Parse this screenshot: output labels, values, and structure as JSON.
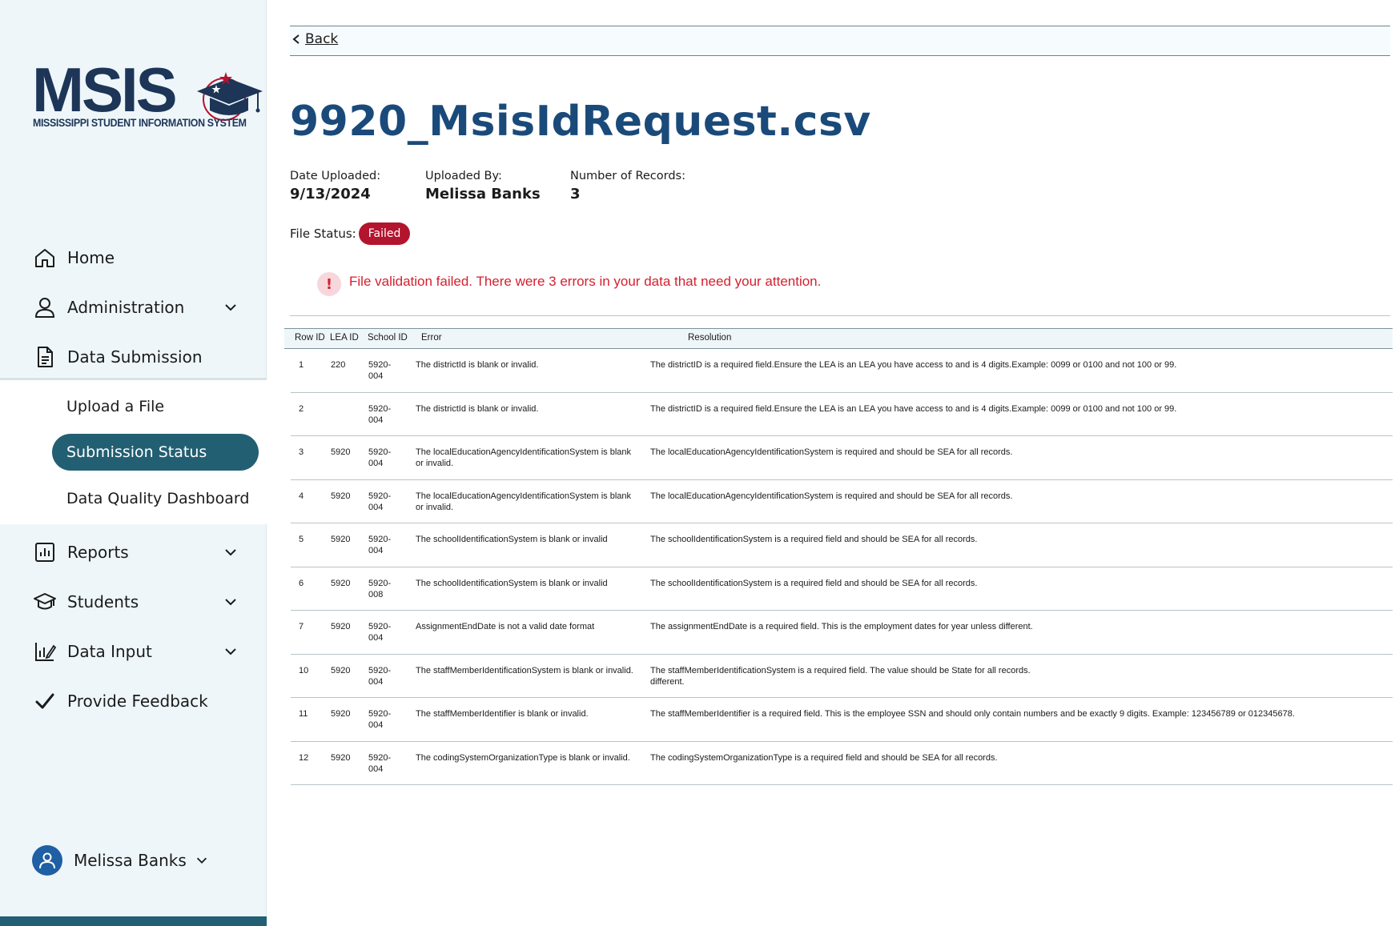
{
  "logo": {
    "word": "MSIS",
    "subtitle": "MISSISSIPPI STUDENT INFORMATION SYSTEM"
  },
  "nav": {
    "home": "Home",
    "administration": "Administration",
    "data_submission": "Data Submission",
    "sub": {
      "upload": "Upload a File",
      "status": "Submission Status",
      "dq": "Data Quality Dashboard"
    },
    "reports": "Reports",
    "students": "Students",
    "data_input": "Data Input",
    "feedback": "Provide Feedback"
  },
  "user": {
    "name": "Melissa Banks"
  },
  "back_label": "Back",
  "file": {
    "name": "9920_MsisIdRequest.csv",
    "date_label": "Date Uploaded:",
    "date": "9/13/2024",
    "by_label": "Uploaded By:",
    "by": "Melissa Banks",
    "records_label": "Number of Records:",
    "records": "3",
    "status_label": "File Status:",
    "status": "Failed"
  },
  "alert": {
    "icon": "!",
    "text": "File validation failed. There were 3 errors in your data that need your attention."
  },
  "colors": {
    "sidebar": "#eef6fa",
    "active_pill": "#235f72",
    "title": "#1a4a7a",
    "failed": "#b3142e",
    "alert": "#d4202f"
  },
  "table": {
    "headers": {
      "row_id": "Row ID",
      "lea_id": "LEA ID",
      "school_id": "School ID",
      "error": "Error",
      "resolution": "Resolution"
    },
    "rows": [
      {
        "row_id": "1",
        "lea_id": "220",
        "school_id": "5920-\n004",
        "error": "The districtId is blank or invalid.",
        "resolution": "The districtID is a required field.Ensure the LEA is an LEA you have access to and is 4 digits.Example: 0099 or 0100 and not 100 or 99."
      },
      {
        "row_id": "2",
        "lea_id": "",
        "school_id": "5920-\n004",
        "error": "The districtId is blank or invalid.",
        "resolution": "The districtID is a required field.Ensure the LEA is an LEA you have access to and is 4 digits.Example: 0099 or 0100 and not 100 or 99."
      },
      {
        "row_id": "3",
        "lea_id": "5920",
        "school_id": "5920-\n004",
        "error": "The localEducationAgencyIdentificationSystem is blank\nor invalid.",
        "resolution": "The localEducationAgencyIdentificationSystem is required and should be SEA for all records."
      },
      {
        "row_id": "4",
        "lea_id": "5920",
        "school_id": "5920-\n004",
        "error": "The localEducationAgencyIdentificationSystem is blank\nor invalid.",
        "resolution": "The localEducationAgencyIdentificationSystem is required and should be SEA for all records."
      },
      {
        "row_id": "5",
        "lea_id": "5920",
        "school_id": "5920-\n004",
        "error": "The schoolIdentificationSystem is blank or invalid",
        "resolution": "The schoolIdentificationSystem is a required field and should be SEA for all records."
      },
      {
        "row_id": "6",
        "lea_id": "5920",
        "school_id": "5920-\n008",
        "error": "The schoolIdentificationSystem is blank or invalid",
        "resolution": "The schoolIdentificationSystem is a required field and should be SEA for all records."
      },
      {
        "row_id": "7",
        "lea_id": "5920",
        "school_id": "5920-\n004",
        "error": "AssignmentEndDate is not a valid date format",
        "resolution": "The assignmentEndDate is a required field. This is the employment dates for year unless different."
      },
      {
        "row_id": "10",
        "lea_id": "5920",
        "school_id": "5920-\n004",
        "error": "The staffMemberIdentificationSystem is blank or invalid.",
        "resolution": "The staffMemberIdentificationSystem is a required field. The value should be State for all records.\ndifferent."
      },
      {
        "row_id": "11",
        "lea_id": "5920",
        "school_id": "5920-\n004",
        "error": "The staffMemberIdentifier is blank or invalid.",
        "resolution": "The staffMemberIdentifier is a required field. This is the employee SSN and should only contain numbers and be exactly 9 digits. Example: 123456789 or 012345678."
      },
      {
        "row_id": "12",
        "lea_id": "5920",
        "school_id": "5920-\n004",
        "error": "The codingSystemOrganizationType is blank or invalid.",
        "resolution": "The codingSystemOrganizationType is a required field and should be SEA for all records."
      }
    ]
  }
}
